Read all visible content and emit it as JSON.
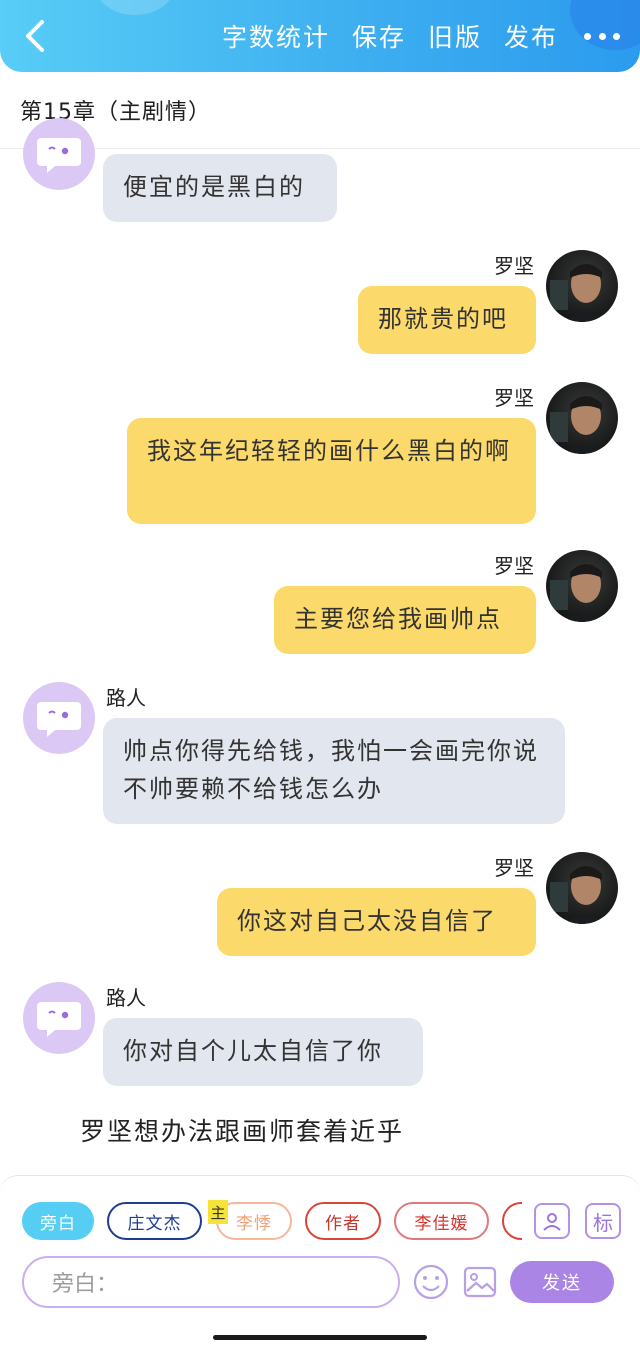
{
  "header": {
    "actions": [
      "字数统计",
      "保存",
      "旧版",
      "发布"
    ],
    "chapter_title": "第15章（主剧情）"
  },
  "messages": [
    {
      "side": "left",
      "name": "",
      "text": "便宜的是黑白的"
    },
    {
      "side": "right",
      "name": "罗坚",
      "text": "那就贵的吧"
    },
    {
      "side": "right",
      "name": "罗坚",
      "text": "我这年纪轻轻的画什么黑白的啊"
    },
    {
      "side": "right",
      "name": "罗坚",
      "text": "主要您给我画帅点"
    },
    {
      "side": "left",
      "name": "路人",
      "text": "帅点你得先给钱，我怕一会画完你说不帅要赖不给钱怎么办"
    },
    {
      "side": "right",
      "name": "罗坚",
      "text": "你这对自己太没自信了"
    },
    {
      "side": "left",
      "name": "路人",
      "text": "你对自个儿太自信了你"
    }
  ],
  "narration": "罗坚想办法跟画师套着近乎",
  "roles": {
    "chips": [
      "旁白",
      "庄文杰",
      "李悸",
      "作者",
      "李佳媛"
    ],
    "main_tag": "主",
    "tag_button": "标"
  },
  "composer": {
    "placeholder": "旁白：",
    "send_label": "发送"
  },
  "colors": {
    "header_gradient_start": "#58cdf6",
    "header_gradient_end": "#2b9bee",
    "left_bubble": "#e1e6ef",
    "right_bubble": "#fbd96a",
    "send_button": "#ab85e6",
    "active_chip": "#56cdf3"
  }
}
